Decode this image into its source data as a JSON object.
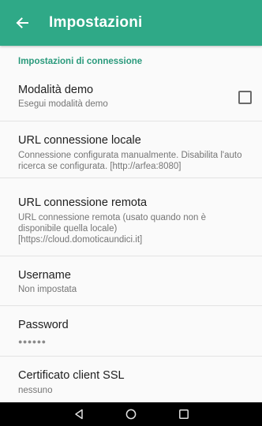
{
  "app_bar": {
    "title": "Impostazioni",
    "back_icon": "arrow-back-icon",
    "color": "#2fa987"
  },
  "section": {
    "header": "Impostazioni di connessione",
    "accent_color": "#2a9a7c"
  },
  "preferences": [
    {
      "title": "Modalità demo",
      "summary": "Esegui modalità demo",
      "checked": false
    },
    {
      "title": "URL connessione locale",
      "summary": "Connessione configurata manualmente. Disabilita l'auto ricerca se configurata. [http://arfea:8080]"
    },
    {
      "title": "URL connessione remota",
      "summary": "URL connessione remota (usato quando non è disponibile quella locale) [https://cloud.domoticaundici.it]"
    },
    {
      "title": "Username",
      "summary": "Non impostata"
    },
    {
      "title": "Password",
      "summary": "●●●●●●"
    },
    {
      "title": "Certificato client SSL",
      "summary": "nessuno"
    }
  ],
  "nav_bar": {
    "back_icon": "triangle-back-icon",
    "home_icon": "circle-home-icon",
    "recents_icon": "square-recents-icon"
  }
}
